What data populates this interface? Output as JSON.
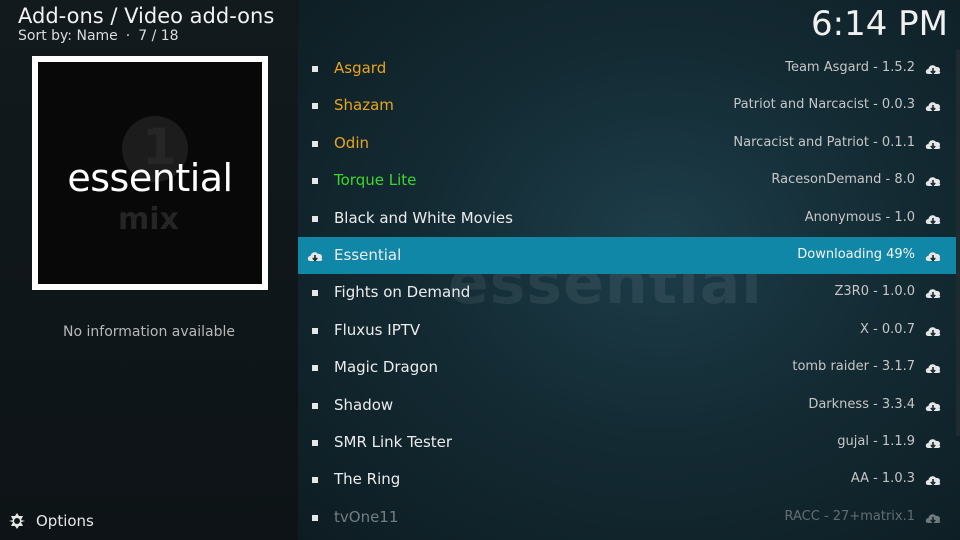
{
  "header": {
    "title": "Add-ons / Video add-ons",
    "sort_label": "Sort by: Name",
    "position": "7 / 18"
  },
  "clock": "6:14 PM",
  "preview": {
    "title_word": "essential",
    "sub_word": "mix",
    "badge": "1",
    "info": "No information available"
  },
  "footer": {
    "options_label": "Options"
  },
  "colors": {
    "highlight": "#1187a8",
    "orange": "#e8a41e",
    "green": "#3ad82e"
  },
  "addons": [
    {
      "name": "Asgard",
      "info": "Team Asgard - 1.5.2",
      "color": "orange"
    },
    {
      "name": "Shazam",
      "info": "Patriot and Narcacist - 0.0.3",
      "color": "orange"
    },
    {
      "name": "Odin",
      "info": "Narcacist and Patriot - 0.1.1",
      "color": "orange"
    },
    {
      "name": "Torque Lite",
      "info": "RacesonDemand - 8.0",
      "color": "green"
    },
    {
      "name": "Black and White Movies",
      "info": "Anonymous - 1.0",
      "color": "white"
    },
    {
      "name": "Essential",
      "info": "Downloading 49%",
      "color": "white",
      "selected": true
    },
    {
      "name": "Fights on Demand",
      "info": "Z3R0 - 1.0.0",
      "color": "white"
    },
    {
      "name": "Fluxus IPTV",
      "info": "X - 0.0.7",
      "color": "white"
    },
    {
      "name": "Magic Dragon",
      "info": "tomb raider - 3.1.7",
      "color": "white"
    },
    {
      "name": "Shadow",
      "info": "Darkness - 3.3.4",
      "color": "white"
    },
    {
      "name": "SMR Link Tester",
      "info": "gujal - 1.1.9",
      "color": "white"
    },
    {
      "name": "The Ring",
      "info": "AA - 1.0.3",
      "color": "white"
    },
    {
      "name": "tvOne11",
      "info": "RACC - 27+matrix.1",
      "color": "white",
      "dim": true
    }
  ]
}
